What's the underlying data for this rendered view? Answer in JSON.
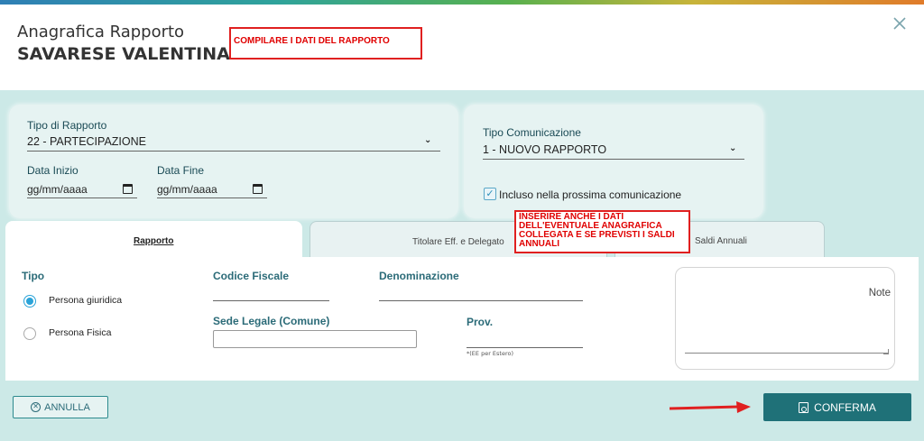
{
  "header": {
    "title": "Anagrafica Rapporto",
    "subtitle": "SAVARESE VALENTINA",
    "close_icon": "close-icon"
  },
  "annotations": {
    "top": "COMPILARE I DATI DEL RAPPORTO",
    "tabs": "INSERIRE ANCHE I DATI DELL'EVENTUALE ANAGRAFICA COLLEGATA E SE PREVISTI I SALDI ANNUALI"
  },
  "rapporto_card": {
    "tipo_label": "Tipo di Rapporto",
    "tipo_value": "22 - PARTECIPAZIONE",
    "data_inizio_label": "Data Inizio",
    "data_inizio_value": "gg/mm/aaaa",
    "data_fine_label": "Data Fine",
    "data_fine_value": "gg/mm/aaaa"
  },
  "comunicazione_card": {
    "tipo_label": "Tipo Comunicazione",
    "tipo_value": "1 - NUOVO RAPPORTO",
    "incluso_label": "Incluso nella prossima comunicazione",
    "incluso_checked": true
  },
  "tabs": [
    {
      "label": "Rapporto",
      "active": true
    },
    {
      "label": "Titolare Eff. e Delegato",
      "active": false
    },
    {
      "label": "Saldi Annuali",
      "active": false
    }
  ],
  "form": {
    "tipo_label": "Tipo",
    "options": [
      "Persona giuridica",
      "Persona Fisica"
    ],
    "selected_option": "Persona giuridica",
    "codice_fiscale_label": "Codice Fiscale",
    "denominazione_label": "Denominazione",
    "sede_label": "Sede Legale (Comune)",
    "prov_label": "Prov.",
    "prov_hint": "*(EE per Estero)",
    "note_label": "Note"
  },
  "footer": {
    "annulla_label": "ANNULLA",
    "conferma_label": "CONFERMA"
  },
  "colors": {
    "accent": "#1f7178",
    "background": "#cce9e7",
    "annotation": "#e02020"
  }
}
